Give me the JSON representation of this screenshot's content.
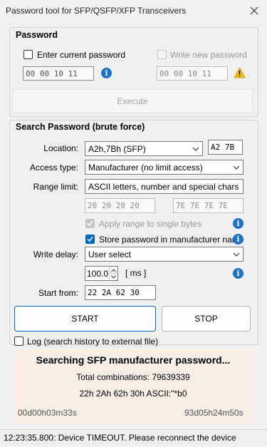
{
  "window": {
    "title": "Password tool for SFP/QSFP/XFP Transceivers"
  },
  "password_group": {
    "title": "Password",
    "enter_current_label": "Enter current password",
    "enter_current_checked": false,
    "write_new_label": "Write new password",
    "write_new_checked": false,
    "current_hex": "00 00 10 11",
    "new_hex": "00 00 10 11",
    "execute_label": "Execute"
  },
  "search_group": {
    "title": "Search Password (brute force)",
    "location_label": "Location:",
    "location_value": "A2h,7Bh (SFP)",
    "location_hex": "A2 7B",
    "access_label": "Access type:",
    "access_value": "Manufacturer (no limit access)",
    "range_label": "Range limit:",
    "range_value": "ASCII letters, number and special chars",
    "range_from_hex": "20 20 20 20",
    "range_to_hex": "7E 7E 7E 7E",
    "apply_range_label": "Apply range to single bytes",
    "apply_range_checked": true,
    "store_pw_label": "Store password in manufacturer name",
    "store_pw_checked": true,
    "write_delay_label": "Write delay:",
    "write_delay_value": "User select",
    "delay_value": "100.0",
    "delay_unit": "[ ms ]",
    "start_from_label": "Start from:",
    "start_from_hex": "22 2A 62 30",
    "start_label": "START",
    "stop_label": "STOP"
  },
  "log": {
    "label": "Log (search history to external file)",
    "checked": false
  },
  "progress": {
    "heading": "Searching SFP manufacturer password...",
    "total_combinations": "Total combinations: 79639339",
    "current_value": "22h 2Ah 62h 30h  ASCII:\"*b0",
    "elapsed": "00d00h03m33s",
    "remaining": "93d05h24m50s"
  },
  "status": {
    "message": "12:23:35.800: Device TIMEOUT. Please reconnect the device"
  },
  "icons": [
    "close-icon",
    "info-icon",
    "warning-icon",
    "chevron-down-icon",
    "checkmark-icon"
  ],
  "colors": {
    "accent": "#0067c0",
    "info": "#1a73c9",
    "warning": "#f2c200",
    "progress_bg": "#f7efe6"
  }
}
